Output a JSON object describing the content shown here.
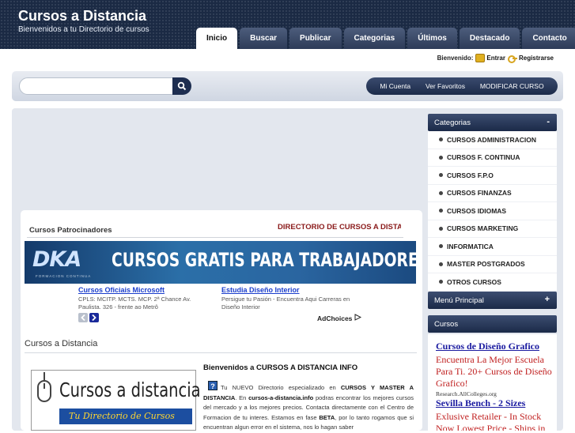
{
  "site": {
    "title": "Cursos a Distancia",
    "subtitle": "Bienvenidos a tu Directorio de cursos"
  },
  "nav": {
    "tabs": [
      {
        "label": "Inicio",
        "active": true
      },
      {
        "label": "Buscar"
      },
      {
        "label": "Publicar"
      },
      {
        "label": "Categorias"
      },
      {
        "label": "Últimos"
      },
      {
        "label": "Destacado"
      },
      {
        "label": "Contacto"
      }
    ]
  },
  "login": {
    "welcome": "Bienvenido:",
    "enter": "Entrar",
    "register": "Registrarse"
  },
  "search": {
    "value": "",
    "placeholder": ""
  },
  "account": {
    "links": [
      "Mi Cuenta",
      "Ver Favoritos",
      "MODIFICAR CURSO"
    ]
  },
  "sponsors": {
    "title": "Cursos Patrocinadores",
    "ticker": "DIRECTORIO DE CURSOS A DISTA"
  },
  "banner": {
    "logo": "DKA",
    "logo_sub": "FORMACION CONTINUA",
    "text": "CURSOS GRATIS PARA TRABAJADORES"
  },
  "ads": [
    {
      "title": "Cursos Oficiais Microsoft",
      "desc": "CPLS: MCITP. MCTS. MCP. 2ª Chance Av. Paulista. 326 - frente ao Metrô"
    },
    {
      "title": "Estudia Diseño Interior",
      "desc": "Persigue tu Pasión - Encuentra Aqui Carreras en Diseño Interior"
    }
  ],
  "adchoices": "AdChoices",
  "section": {
    "title": "Cursos a Distancia"
  },
  "logo": {
    "main": "Cursos a distancia",
    "sub": "Tu Directorio de Cursos"
  },
  "welcome": {
    "title": "Bienvenidos a CURSOS A DISTANCIA INFO",
    "icon": "?",
    "text_1": "Tu NUEVO Directorio especializado en ",
    "text_bold_1": "CURSOS Y MASTER A DISTANCIA",
    "text_2": ". En ",
    "text_bold_2": "cursos-a-distancia.info",
    "text_3": " podras encontrar los mejores cursos del mercado y a los mejores precios. Contacta directamente con el Centro de Formacion de tu interes. Estamos en fase ",
    "text_bold_3": "BETA",
    "text_4": ", por lo tanto rogamos que si encuentran algun error en el sistema, nos lo hagan saber"
  },
  "sidebar": {
    "categorias_head": "Categorias",
    "categorias_toggle": "-",
    "categories": [
      "CURSOS ADMINISTRACION",
      "CURSOS F. CONTINUA",
      "CURSOS F.P.O",
      "CURSOS FINANZAS",
      "CURSOS IDIOMAS",
      "CURSOS MARKETING",
      "INFORMATICA",
      "MASTER POSTGRADOS",
      "OTROS CURSOS"
    ],
    "menu_head": "Menú Principal",
    "menu_toggle": "+",
    "cursos_head": "Cursos",
    "ads": [
      {
        "title": "Cursos de Diseño Grafico",
        "desc": "Encuentra La Mejor Escuela Para Ti. 20+ Cursos de Diseño Grafico!",
        "url": "Research.AllColleges.org"
      },
      {
        "title": "Sevilla Bench - 2 Sizes",
        "desc": "Exlusive Retailer - In Stock Now Lowest Price - Ships in"
      }
    ]
  },
  "colors": {
    "header": "#1b2a44",
    "accent_red": "#8a1a1a",
    "link_blue": "#1a3dcc"
  }
}
